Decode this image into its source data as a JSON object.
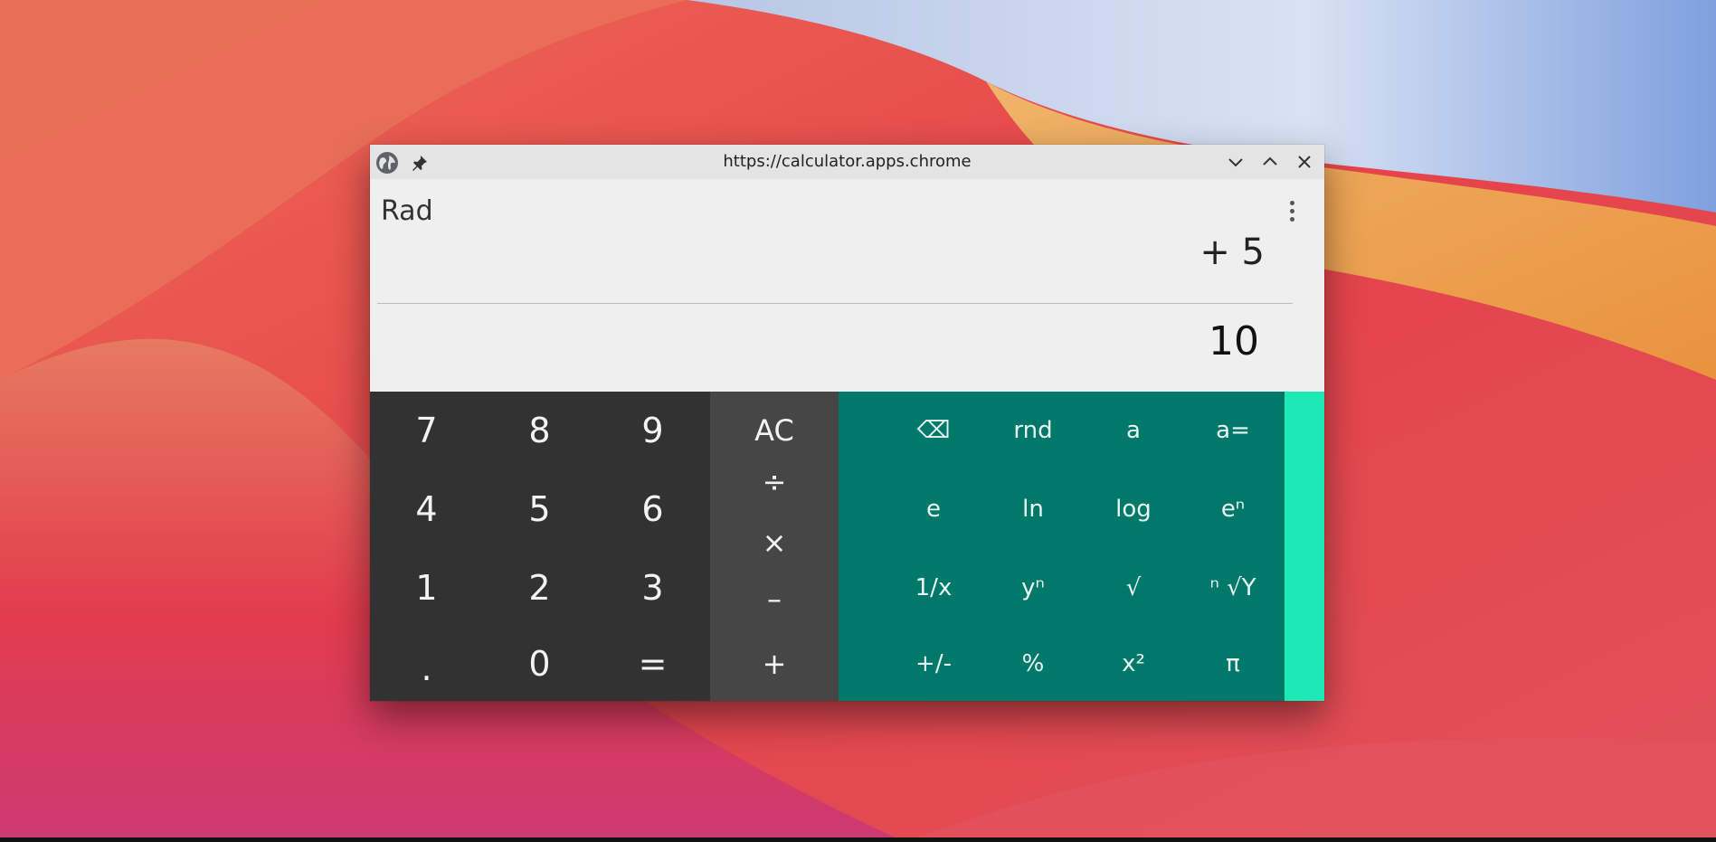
{
  "window": {
    "url": "https://calculator.apps.chrome",
    "icons": {
      "globe": "globe-icon",
      "pin": "pin-icon",
      "minimize": "chevron-down-icon",
      "maximize": "chevron-up-icon",
      "close": "close-icon"
    }
  },
  "display": {
    "mode": "Rad",
    "expression": "+ 5",
    "result": "10",
    "menu_icon": "more-vert-icon"
  },
  "keypad": {
    "numbers": [
      [
        "7",
        "8",
        "9"
      ],
      [
        "4",
        "5",
        "6"
      ],
      [
        "1",
        "2",
        "3"
      ],
      [
        ".",
        "0",
        "="
      ]
    ],
    "operators": [
      "AC",
      "÷",
      "×",
      "–",
      "+"
    ],
    "scientific": [
      [
        "⌫",
        "rnd",
        "a",
        "a="
      ],
      [
        "e",
        "ln",
        "log",
        "eⁿ"
      ],
      [
        "1/x",
        "yⁿ",
        "√",
        "ⁿ √Y"
      ],
      [
        "+/-",
        "%",
        "x²",
        "π"
      ]
    ]
  },
  "colors": {
    "numpad": "#323232",
    "operators": "#464646",
    "scientific": "#00786a",
    "accent_edge": "#1de9b6",
    "display": "#efefef",
    "titlebar": "#e4e4e4"
  }
}
